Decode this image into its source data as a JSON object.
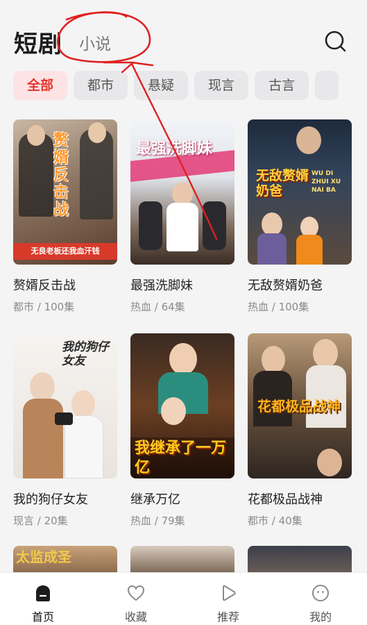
{
  "header": {
    "active_tab": "短剧",
    "secondary_tab": "小说"
  },
  "categories": [
    "全部",
    "都市",
    "悬疑",
    "现言",
    "古言"
  ],
  "dramas": [
    {
      "title": "赘婿反击战",
      "meta": "都市 / 100集",
      "poster_text": "赘婿 反击战",
      "poster_caption": "无良老板还我血汗钱"
    },
    {
      "title": "最强洗脚妹",
      "meta": "热血 / 64集",
      "poster_text": "最强洗脚妹"
    },
    {
      "title": "无敌赘婿奶爸",
      "meta": "热血 / 100集",
      "poster_text": "无敌赘婿奶爸",
      "poster_caption": "WU DI ZHUI XU NAI BA"
    },
    {
      "title": "我的狗仔女友",
      "meta": "现言 / 20集",
      "poster_text": "我的狗仔女友"
    },
    {
      "title": "继承万亿",
      "meta": "热血 / 79集",
      "poster_text": "我继承了一万亿"
    },
    {
      "title": "花都极品战神",
      "meta": "都市 / 40集",
      "poster_text": "花都极品战神"
    }
  ],
  "partial_posters": [
    "太监成圣"
  ],
  "bottom_nav": [
    {
      "label": "首页",
      "icon": "home-icon"
    },
    {
      "label": "收藏",
      "icon": "heart-icon"
    },
    {
      "label": "推荐",
      "icon": "play-icon"
    },
    {
      "label": "我的",
      "icon": "profile-icon"
    }
  ],
  "colors": {
    "accent": "#e5362e",
    "annotation": "#e02020"
  }
}
